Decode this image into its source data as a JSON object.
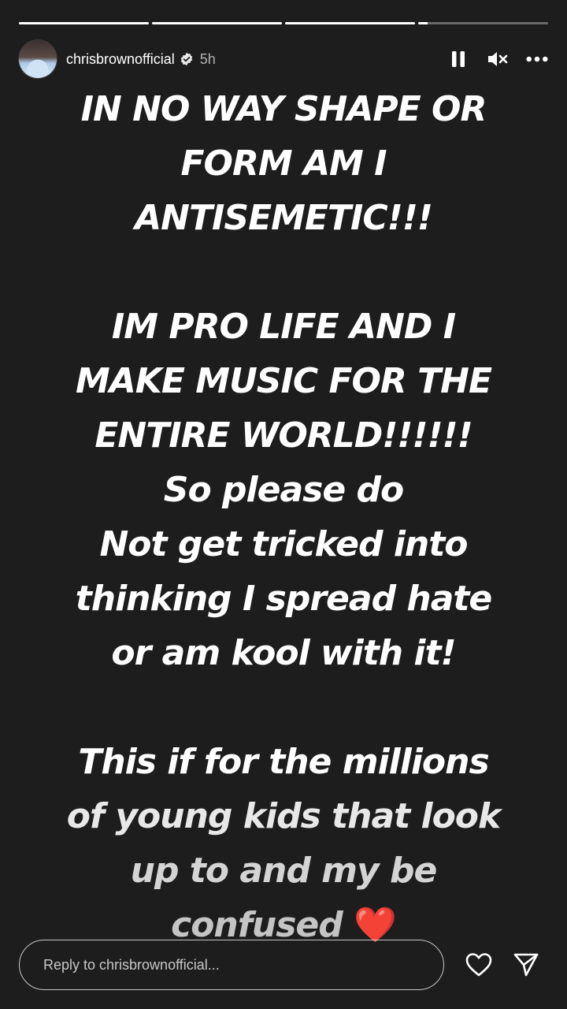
{
  "progress": {
    "segments": [
      1,
      1,
      1,
      0.07
    ]
  },
  "header": {
    "username": "chrisbrownofficial",
    "time": "5h",
    "icons": [
      "avatar",
      "verified-icon",
      "pause-icon",
      "mute-icon",
      "more-icon"
    ]
  },
  "message": {
    "lines": [
      "IN NO WAY SHAPE OR",
      "FORM AM I",
      "ANTISEMETIC!!!",
      "",
      "IM PRO LIFE AND I",
      "MAKE MUSIC FOR THE",
      "ENTIRE WORLD!!!!!!",
      "So please do",
      "Not get tricked into",
      "thinking I spread hate",
      "or am kool with it!",
      "",
      "This if for the millions",
      "of young kids that look",
      "up to and my be",
      "confused"
    ],
    "emoji": "❤️"
  },
  "footer": {
    "reply_placeholder": "Reply to chrisbrownofficial...",
    "icons": [
      "heart-icon",
      "send-icon"
    ]
  },
  "colors": {
    "background": "#1d1d1d",
    "text": "#ffffff",
    "heart": "#d0141e"
  }
}
